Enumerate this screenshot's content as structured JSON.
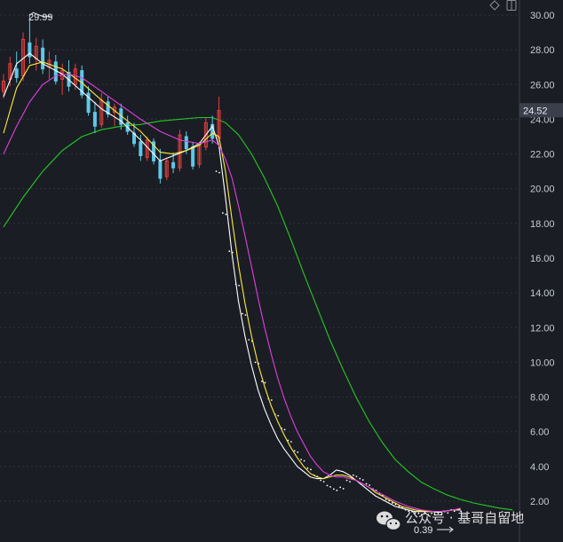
{
  "chart_data": {
    "type": "candlestick-with-moving-averages",
    "y_axis": {
      "position": "right",
      "ticks": [
        "30.00",
        "28.00",
        "26.00",
        "24.00",
        "22.00",
        "20.00",
        "18.00",
        "16.00",
        "14.00",
        "12.00",
        "10.00",
        "8.00",
        "6.00",
        "4.00",
        "2.00"
      ],
      "range": [
        1.1,
        30.6
      ]
    },
    "current_price": "24.52",
    "current_price_value": 24.52,
    "annotations": {
      "high_label": "29.99",
      "high_value": 29.99,
      "low_label": "0.39"
    },
    "colors": {
      "up": "#e0403c",
      "down": "#5ec8e8",
      "ma_white": "#ffffff",
      "ma_yellow": "#ffeb3b",
      "ma_magenta": "#e040e0",
      "ma_green": "#22cc22"
    },
    "candles": [
      {
        "o": 25.6,
        "h": 26.6,
        "l": 25.2,
        "c": 26.2
      },
      {
        "o": 26.3,
        "h": 27.6,
        "l": 25.9,
        "c": 27.2
      },
      {
        "o": 26.9,
        "h": 27.9,
        "l": 26.1,
        "c": 26.4
      },
      {
        "o": 26.5,
        "h": 29.0,
        "l": 26.2,
        "c": 28.6
      },
      {
        "o": 28.4,
        "h": 29.99,
        "l": 27.2,
        "c": 27.6
      },
      {
        "o": 27.5,
        "h": 28.7,
        "l": 26.8,
        "c": 28.2
      },
      {
        "o": 28.1,
        "h": 28.6,
        "l": 26.6,
        "c": 26.9
      },
      {
        "o": 27.0,
        "h": 27.9,
        "l": 26.3,
        "c": 27.4
      },
      {
        "o": 27.3,
        "h": 27.7,
        "l": 26.0,
        "c": 26.2
      },
      {
        "o": 26.3,
        "h": 27.2,
        "l": 25.4,
        "c": 26.8
      },
      {
        "o": 26.7,
        "h": 27.4,
        "l": 25.6,
        "c": 25.9
      },
      {
        "o": 26.0,
        "h": 27.2,
        "l": 25.7,
        "c": 26.9
      },
      {
        "o": 26.8,
        "h": 27.1,
        "l": 25.2,
        "c": 25.4
      },
      {
        "o": 25.5,
        "h": 25.9,
        "l": 24.2,
        "c": 24.4
      },
      {
        "o": 24.4,
        "h": 25.0,
        "l": 23.2,
        "c": 23.6
      },
      {
        "o": 23.7,
        "h": 25.5,
        "l": 23.5,
        "c": 25.1
      },
      {
        "o": 25.0,
        "h": 25.3,
        "l": 24.1,
        "c": 24.3
      },
      {
        "o": 24.4,
        "h": 24.9,
        "l": 23.6,
        "c": 24.7
      },
      {
        "o": 24.6,
        "h": 24.9,
        "l": 23.4,
        "c": 23.7
      },
      {
        "o": 23.8,
        "h": 24.2,
        "l": 23.1,
        "c": 23.3
      },
      {
        "o": 23.2,
        "h": 23.8,
        "l": 22.4,
        "c": 22.6
      },
      {
        "o": 22.7,
        "h": 23.1,
        "l": 21.6,
        "c": 21.9
      },
      {
        "o": 21.8,
        "h": 23.0,
        "l": 21.6,
        "c": 22.8
      },
      {
        "o": 22.7,
        "h": 22.9,
        "l": 21.4,
        "c": 21.6
      },
      {
        "o": 21.6,
        "h": 22.3,
        "l": 20.3,
        "c": 20.6
      },
      {
        "o": 20.7,
        "h": 21.8,
        "l": 20.5,
        "c": 21.6
      },
      {
        "o": 21.5,
        "h": 22.1,
        "l": 20.9,
        "c": 21.2
      },
      {
        "o": 21.2,
        "h": 23.4,
        "l": 21.0,
        "c": 23.1
      },
      {
        "o": 23.0,
        "h": 23.3,
        "l": 22.0,
        "c": 22.3
      },
      {
        "o": 22.4,
        "h": 22.7,
        "l": 21.1,
        "c": 21.3
      },
      {
        "o": 21.4,
        "h": 22.7,
        "l": 21.2,
        "c": 22.5
      },
      {
        "o": 22.4,
        "h": 24.1,
        "l": 22.2,
        "c": 23.8
      },
      {
        "o": 23.7,
        "h": 24.2,
        "l": 22.6,
        "c": 22.9
      },
      {
        "o": 22.9,
        "h": 25.3,
        "l": 22.7,
        "c": 24.5
      }
    ],
    "dot_series": [
      {
        "x": 33,
        "y": 21.0
      },
      {
        "x": 34,
        "y": 18.6
      },
      {
        "x": 35,
        "y": 16.4
      },
      {
        "x": 36,
        "y": 14.5
      },
      {
        "x": 37,
        "y": 12.8
      },
      {
        "x": 38,
        "y": 11.3
      },
      {
        "x": 39,
        "y": 10.0
      },
      {
        "x": 40,
        "y": 8.9
      },
      {
        "x": 41,
        "y": 7.9
      },
      {
        "x": 42,
        "y": 7.0
      },
      {
        "x": 43,
        "y": 6.2
      },
      {
        "x": 44,
        "y": 5.5
      },
      {
        "x": 45,
        "y": 4.9
      },
      {
        "x": 46,
        "y": 4.4
      },
      {
        "x": 47,
        "y": 3.9
      },
      {
        "x": 48,
        "y": 3.5
      },
      {
        "x": 49,
        "y": 3.2
      },
      {
        "x": 50,
        "y": 2.9
      },
      {
        "x": 51,
        "y": 2.7
      },
      {
        "x": 52,
        "y": 2.8
      },
      {
        "x": 53,
        "y": 3.2
      },
      {
        "x": 54,
        "y": 3.5
      },
      {
        "x": 55,
        "y": 3.3
      },
      {
        "x": 56,
        "y": 3.0
      },
      {
        "x": 57,
        "y": 2.7
      },
      {
        "x": 58,
        "y": 2.4
      },
      {
        "x": 59,
        "y": 2.1
      },
      {
        "x": 60,
        "y": 1.9
      },
      {
        "x": 61,
        "y": 1.7
      },
      {
        "x": 62,
        "y": 1.5
      },
      {
        "x": 63,
        "y": 1.4
      },
      {
        "x": 64,
        "y": 1.3
      },
      {
        "x": 65,
        "y": 1.3
      },
      {
        "x": 66,
        "y": 1.3
      },
      {
        "x": 67,
        "y": 1.3
      },
      {
        "x": 68,
        "y": 1.4
      },
      {
        "x": 69,
        "y": 1.5
      },
      {
        "x": 70,
        "y": 1.5
      }
    ],
    "moving_averages": [
      {
        "color": "ma_white",
        "points": [
          [
            0,
            25.3
          ],
          [
            2,
            27.2
          ],
          [
            4,
            27.8
          ],
          [
            6,
            27.2
          ],
          [
            9,
            26.6
          ],
          [
            12,
            25.6
          ],
          [
            15,
            24.6
          ],
          [
            18,
            23.9
          ],
          [
            21,
            22.8
          ],
          [
            24,
            21.6
          ],
          [
            26,
            21.9
          ],
          [
            28,
            22.2
          ],
          [
            30,
            22.6
          ],
          [
            32,
            23.6
          ],
          [
            33,
            22.5
          ],
          [
            34,
            19.5
          ],
          [
            35,
            16.2
          ],
          [
            36,
            13.5
          ],
          [
            37,
            11.5
          ],
          [
            38,
            9.8
          ],
          [
            39,
            8.4
          ],
          [
            40,
            7.3
          ],
          [
            41,
            6.4
          ],
          [
            42,
            5.6
          ],
          [
            43,
            5.0
          ],
          [
            44,
            4.5
          ],
          [
            45,
            4.0
          ],
          [
            46,
            3.7
          ],
          [
            47,
            3.4
          ],
          [
            48,
            3.3
          ],
          [
            49,
            3.3
          ],
          [
            50,
            3.5
          ],
          [
            51,
            3.8
          ],
          [
            52,
            3.7
          ],
          [
            53,
            3.5
          ],
          [
            54,
            3.2
          ],
          [
            55,
            2.9
          ],
          [
            56,
            2.6
          ],
          [
            57,
            2.3
          ],
          [
            58,
            2.1
          ],
          [
            59,
            1.9
          ],
          [
            60,
            1.7
          ],
          [
            61,
            1.6
          ],
          [
            62,
            1.5
          ],
          [
            63,
            1.4
          ],
          [
            64,
            1.4
          ],
          [
            65,
            1.4
          ],
          [
            66,
            1.4
          ],
          [
            67,
            1.4
          ],
          [
            68,
            1.45
          ],
          [
            69,
            1.5
          ],
          [
            70,
            1.5
          ]
        ]
      },
      {
        "color": "ma_yellow",
        "points": [
          [
            0,
            23.2
          ],
          [
            2,
            25.8
          ],
          [
            4,
            27.1
          ],
          [
            6,
            27.3
          ],
          [
            9,
            26.9
          ],
          [
            12,
            26.1
          ],
          [
            15,
            25.1
          ],
          [
            18,
            24.2
          ],
          [
            21,
            23.3
          ],
          [
            24,
            22.1
          ],
          [
            26,
            22.0
          ],
          [
            28,
            22.2
          ],
          [
            30,
            22.5
          ],
          [
            32,
            23.2
          ],
          [
            33,
            23.0
          ],
          [
            34,
            21.0
          ],
          [
            35,
            18.2
          ],
          [
            36,
            15.6
          ],
          [
            37,
            13.4
          ],
          [
            38,
            11.5
          ],
          [
            39,
            9.9
          ],
          [
            40,
            8.6
          ],
          [
            41,
            7.5
          ],
          [
            42,
            6.6
          ],
          [
            43,
            5.8
          ],
          [
            44,
            5.1
          ],
          [
            45,
            4.5
          ],
          [
            46,
            4.0
          ],
          [
            47,
            3.6
          ],
          [
            48,
            3.4
          ],
          [
            49,
            3.3
          ],
          [
            50,
            3.4
          ],
          [
            51,
            3.5
          ],
          [
            52,
            3.5
          ],
          [
            53,
            3.4
          ],
          [
            54,
            3.2
          ],
          [
            55,
            3.0
          ],
          [
            56,
            2.8
          ],
          [
            57,
            2.5
          ],
          [
            58,
            2.3
          ],
          [
            59,
            2.1
          ],
          [
            60,
            1.9
          ],
          [
            61,
            1.7
          ],
          [
            62,
            1.6
          ],
          [
            63,
            1.5
          ],
          [
            64,
            1.45
          ],
          [
            65,
            1.4
          ],
          [
            66,
            1.4
          ],
          [
            67,
            1.4
          ],
          [
            68,
            1.45
          ],
          [
            69,
            1.5
          ],
          [
            70,
            1.55
          ]
        ]
      },
      {
        "color": "ma_magenta",
        "points": [
          [
            0,
            22.0
          ],
          [
            2,
            23.6
          ],
          [
            4,
            25.0
          ],
          [
            6,
            26.0
          ],
          [
            8,
            26.5
          ],
          [
            10,
            26.6
          ],
          [
            12,
            26.4
          ],
          [
            15,
            25.6
          ],
          [
            18,
            24.8
          ],
          [
            21,
            24.0
          ],
          [
            24,
            23.3
          ],
          [
            27,
            22.8
          ],
          [
            30,
            22.6
          ],
          [
            32,
            22.8
          ],
          [
            33,
            22.5
          ],
          [
            34,
            21.7
          ],
          [
            35,
            20.6
          ],
          [
            36,
            19.0
          ],
          [
            37,
            17.3
          ],
          [
            38,
            15.5
          ],
          [
            39,
            13.7
          ],
          [
            40,
            12.0
          ],
          [
            41,
            10.5
          ],
          [
            42,
            9.1
          ],
          [
            43,
            7.9
          ],
          [
            44,
            6.9
          ],
          [
            45,
            6.0
          ],
          [
            46,
            5.3
          ],
          [
            47,
            4.6
          ],
          [
            48,
            4.1
          ],
          [
            49,
            3.7
          ],
          [
            50,
            3.5
          ],
          [
            51,
            3.4
          ],
          [
            52,
            3.4
          ],
          [
            53,
            3.3
          ],
          [
            54,
            3.2
          ],
          [
            55,
            3.0
          ],
          [
            56,
            2.8
          ],
          [
            57,
            2.6
          ],
          [
            58,
            2.4
          ],
          [
            59,
            2.2
          ],
          [
            60,
            2.0
          ],
          [
            61,
            1.85
          ],
          [
            62,
            1.7
          ],
          [
            63,
            1.6
          ],
          [
            64,
            1.5
          ],
          [
            65,
            1.45
          ],
          [
            66,
            1.4
          ],
          [
            67,
            1.4
          ],
          [
            68,
            1.45
          ],
          [
            69,
            1.5
          ],
          [
            70,
            1.6
          ]
        ]
      },
      {
        "color": "ma_green",
        "points": [
          [
            0,
            17.8
          ],
          [
            3,
            19.5
          ],
          [
            6,
            21.0
          ],
          [
            9,
            22.2
          ],
          [
            12,
            23.0
          ],
          [
            15,
            23.4
          ],
          [
            18,
            23.6
          ],
          [
            21,
            23.7
          ],
          [
            24,
            23.9
          ],
          [
            27,
            24.0
          ],
          [
            30,
            24.1
          ],
          [
            32,
            24.1
          ],
          [
            34,
            23.8
          ],
          [
            36,
            23.1
          ],
          [
            38,
            22.0
          ],
          [
            40,
            20.6
          ],
          [
            42,
            19.0
          ],
          [
            44,
            17.1
          ],
          [
            46,
            15.1
          ],
          [
            48,
            13.2
          ],
          [
            50,
            11.3
          ],
          [
            52,
            9.6
          ],
          [
            54,
            8.0
          ],
          [
            56,
            6.6
          ],
          [
            58,
            5.4
          ],
          [
            60,
            4.4
          ],
          [
            62,
            3.7
          ],
          [
            64,
            3.1
          ],
          [
            66,
            2.7
          ],
          [
            68,
            2.35
          ],
          [
            70,
            2.1
          ],
          [
            72,
            1.9
          ],
          [
            74,
            1.75
          ],
          [
            76,
            1.6
          ],
          [
            78,
            1.5
          ]
        ]
      }
    ]
  },
  "toolbar": {
    "icons": [
      "diamond-icon",
      "window-icon"
    ]
  },
  "watermark": {
    "text": "公众号 · 基哥自留地",
    "icon": "wechat-icon"
  }
}
